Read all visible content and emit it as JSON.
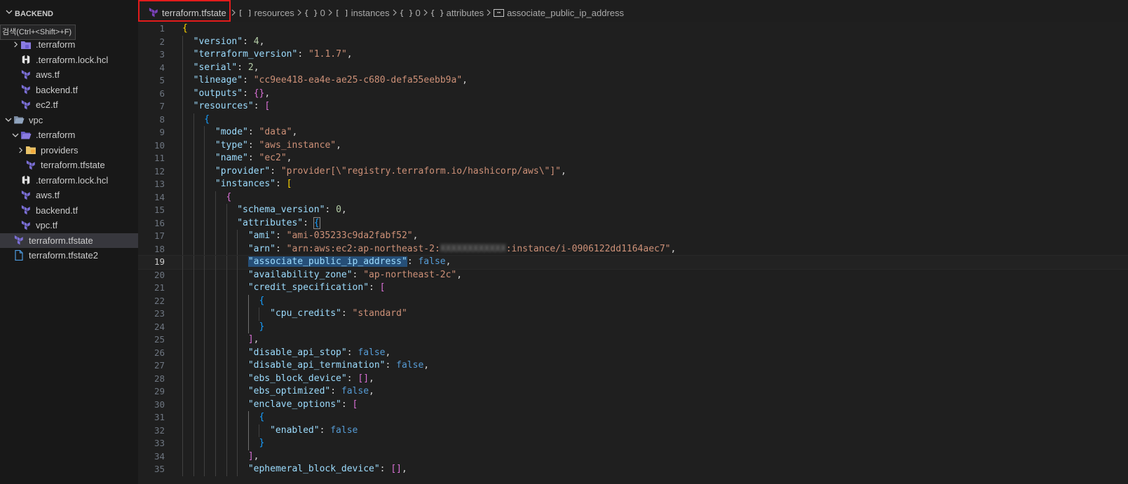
{
  "sidebar": {
    "title": "BACKEND",
    "tooltip": "검색(Ctrl+<Shift>+F)",
    "items": [
      {
        "label": ".terraform",
        "type": "folder-closed",
        "depth": 1
      },
      {
        "label": ".terraform.lock.hcl",
        "type": "hcl",
        "depth": 1
      },
      {
        "label": "aws.tf",
        "type": "tf",
        "depth": 1
      },
      {
        "label": "backend.tf",
        "type": "tf",
        "depth": 1
      },
      {
        "label": "ec2.tf",
        "type": "tf",
        "depth": 1
      },
      {
        "label": "vpc",
        "type": "folder-open",
        "depth": 0
      },
      {
        "label": ".terraform",
        "type": "folder-open",
        "depth": 1
      },
      {
        "label": "providers",
        "type": "folder-closed",
        "depth": 2
      },
      {
        "label": "terraform.tfstate",
        "type": "tf",
        "depth": 2
      },
      {
        "label": ".terraform.lock.hcl",
        "type": "hcl",
        "depth": 1
      },
      {
        "label": "aws.tf",
        "type": "tf",
        "depth": 1
      },
      {
        "label": "backend.tf",
        "type": "tf",
        "depth": 1
      },
      {
        "label": "vpc.tf",
        "type": "tf",
        "depth": 1
      },
      {
        "label": "terraform.tfstate",
        "type": "tf",
        "depth": 0
      },
      {
        "label": "terraform.tfstate2",
        "type": "file",
        "depth": 0
      }
    ]
  },
  "breadcrumb": {
    "file": "terraform.tfstate",
    "segments": [
      {
        "sym": "[ ]",
        "label": "resources"
      },
      {
        "sym": "{ }",
        "label": "0"
      },
      {
        "sym": "[ ]",
        "label": "instances"
      },
      {
        "sym": "{ }",
        "label": "0"
      },
      {
        "sym": "{ }",
        "label": "attributes"
      },
      {
        "sym": "box",
        "label": "associate_public_ip_address"
      }
    ]
  },
  "editor": {
    "current_line": 19,
    "lines": [
      {
        "n": "1",
        "text": "{"
      },
      {
        "n": "2",
        "text": "\"version\": 4,"
      },
      {
        "n": "3",
        "text": "\"terraform_version\": \"1.1.7\","
      },
      {
        "n": "4",
        "text": "\"serial\": 2,"
      },
      {
        "n": "5",
        "text": "\"lineage\": \"cc9ee418-ea4e-ae25-c680-defa55eebb9a\","
      },
      {
        "n": "6",
        "text": "\"outputs\": {},"
      },
      {
        "n": "7",
        "text": "\"resources\": ["
      },
      {
        "n": "8",
        "text": "{"
      },
      {
        "n": "9",
        "text": "\"mode\": \"data\","
      },
      {
        "n": "10",
        "text": "\"type\": \"aws_instance\","
      },
      {
        "n": "11",
        "text": "\"name\": \"ec2\","
      },
      {
        "n": "12",
        "text": "\"provider\": \"provider[\\\"registry.terraform.io/hashicorp/aws\\\"]\","
      },
      {
        "n": "13",
        "text": "\"instances\": ["
      },
      {
        "n": "14",
        "text": "{"
      },
      {
        "n": "15",
        "text": "\"schema_version\": 0,"
      },
      {
        "n": "16",
        "text": "\"attributes\": {"
      },
      {
        "n": "17",
        "text": "\"ami\": \"ami-035233c9da2fabf52\","
      },
      {
        "n": "18",
        "text": "\"arn\": \"arn:aws:ec2:ap-northeast-2:XXXXXXXXXXXX:instance/i-0906122dd1164aec7\","
      },
      {
        "n": "19",
        "text": "\"associate_public_ip_address\": false,"
      },
      {
        "n": "20",
        "text": "\"availability_zone\": \"ap-northeast-2c\","
      },
      {
        "n": "21",
        "text": "\"credit_specification\": ["
      },
      {
        "n": "22",
        "text": "{"
      },
      {
        "n": "23",
        "text": "\"cpu_credits\": \"standard\""
      },
      {
        "n": "24",
        "text": "}"
      },
      {
        "n": "25",
        "text": "],"
      },
      {
        "n": "26",
        "text": "\"disable_api_stop\": false,"
      },
      {
        "n": "27",
        "text": "\"disable_api_termination\": false,"
      },
      {
        "n": "28",
        "text": "\"ebs_block_device\": [],"
      },
      {
        "n": "29",
        "text": "\"ebs_optimized\": false,"
      },
      {
        "n": "30",
        "text": "\"enclave_options\": ["
      },
      {
        "n": "31",
        "text": "{"
      },
      {
        "n": "32",
        "text": "\"enabled\": false"
      },
      {
        "n": "33",
        "text": "}"
      },
      {
        "n": "34",
        "text": "],"
      },
      {
        "n": "35",
        "text": "\"ephemeral_block_device\": [],"
      }
    ]
  },
  "colors": {
    "key": "#9cdcfe",
    "string": "#ce9178",
    "number": "#b5cea8",
    "boolean": "#569cd6",
    "bracket_level1": "#ffd700",
    "bracket_level2": "#da70d6",
    "bracket_level3": "#179fff",
    "highlight_box": "#e21b1b"
  }
}
